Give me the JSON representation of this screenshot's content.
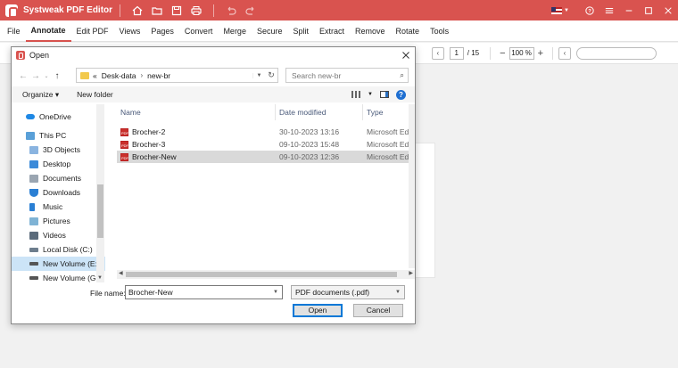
{
  "app": {
    "title": "Systweak PDF Editor",
    "accent": "#d9534f"
  },
  "menu": [
    "File",
    "Annotate",
    "Edit PDF",
    "Views",
    "Pages",
    "Convert",
    "Merge",
    "Secure",
    "Split",
    "Extract",
    "Remove",
    "Rotate",
    "Tools"
  ],
  "menu_active": "Annotate",
  "pager": {
    "current": "1",
    "total": "/ 15",
    "zoom": "100 %"
  },
  "dialog": {
    "title": "Open",
    "breadcrumb": [
      "«",
      "Desk-data",
      "new-br"
    ],
    "search_placeholder": "Search new-br",
    "organize": "Organize ▾",
    "new_folder": "New folder",
    "nav": [
      {
        "label": "OneDrive",
        "icon": "onedrive-icon",
        "sub": false
      },
      {
        "label": "This PC",
        "icon": "pc-icon",
        "sub": false
      },
      {
        "label": "3D Objects",
        "icon": "cube-icon",
        "sub": true
      },
      {
        "label": "Desktop",
        "icon": "desktop-icon",
        "sub": true
      },
      {
        "label": "Documents",
        "icon": "documents-icon",
        "sub": true
      },
      {
        "label": "Downloads",
        "icon": "download-icon",
        "sub": true
      },
      {
        "label": "Music",
        "icon": "music-icon",
        "sub": true
      },
      {
        "label": "Pictures",
        "icon": "pictures-icon",
        "sub": true
      },
      {
        "label": "Videos",
        "icon": "videos-icon",
        "sub": true
      },
      {
        "label": "Local Disk (C:)",
        "icon": "disk-icon",
        "sub": true
      },
      {
        "label": "New Volume (E:)",
        "icon": "disk-icon",
        "sub": true,
        "selected": true
      },
      {
        "label": "New Volume (G:",
        "icon": "disk-icon",
        "sub": true
      }
    ],
    "columns": {
      "name": "Name",
      "date": "Date modified",
      "type": "Type"
    },
    "files": [
      {
        "name": "Brocher-2",
        "date": "30-10-2023 13:16",
        "type": "Microsoft Edge P"
      },
      {
        "name": "Brocher-3",
        "date": "09-10-2023 15:48",
        "type": "Microsoft Edge P"
      },
      {
        "name": "Brocher-New",
        "date": "09-10-2023 12:36",
        "type": "Microsoft Edge P",
        "selected": true
      }
    ],
    "filename_label": "File name:",
    "filename_value": "Brocher-New",
    "filetype_value": "PDF documents (.pdf)",
    "open_label": "Open",
    "cancel_label": "Cancel"
  }
}
